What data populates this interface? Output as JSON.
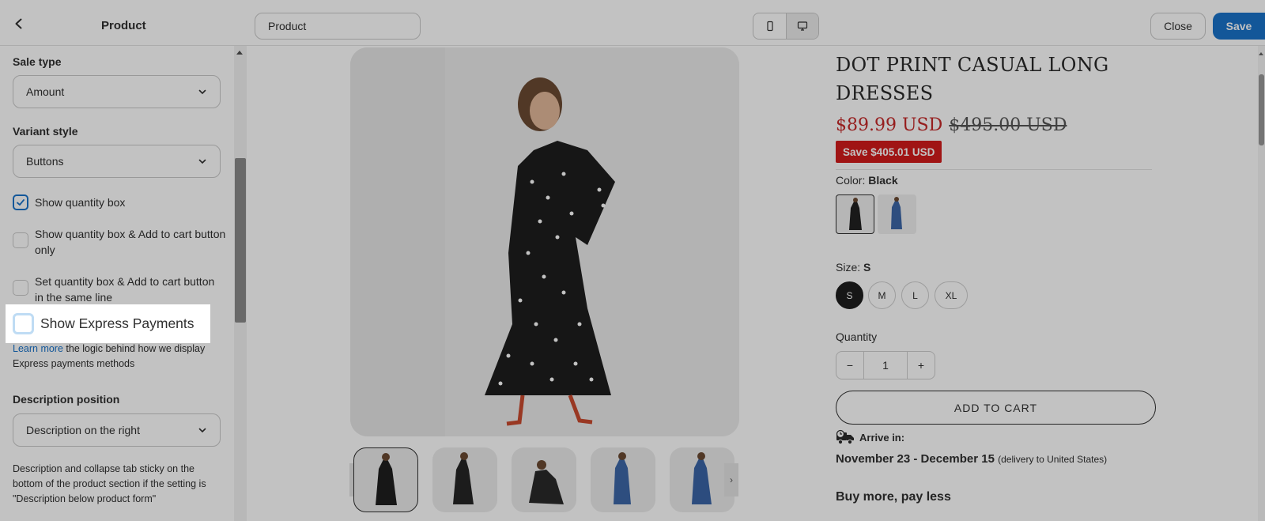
{
  "topbar": {
    "title": "Product",
    "page_select": "Product",
    "close_label": "Close",
    "save_label": "Save",
    "save_color": "#1a73c9"
  },
  "sidebar": {
    "sale_type_heading": "Sale type",
    "sale_type_value": "Amount",
    "variant_style_heading": "Variant style",
    "variant_style_value": "Buttons",
    "checkboxes": [
      {
        "label": "Show quantity box",
        "checked": true
      },
      {
        "label": "Show quantity box & Add to cart button only",
        "checked": false
      },
      {
        "label": "Set quantity box & Add to cart button in the same line",
        "checked": false
      },
      {
        "label": "Show Express Payments",
        "checked": false
      }
    ],
    "learn_more_link": "Learn more",
    "learn_more_text": " the logic behind how we display Express payments methods",
    "description_position_heading": "Description position",
    "description_position_value": "Description on the right",
    "description_note": "Description and collapse tab sticky on the bottom of the product section if the setting is \"Description below product form\""
  },
  "product": {
    "title": "DOT PRINT CASUAL LONG DRESSES",
    "price": "$89.99 USD",
    "compare_price": "$495.00 USD",
    "save_badge": "Save $405.01 USD",
    "color_label": "Color:",
    "color_value": "Black",
    "size_label": "Size:",
    "size_value": "S",
    "sizes": [
      "S",
      "M",
      "L",
      "XL"
    ],
    "quantity_label": "Quantity",
    "quantity_value": "1",
    "quantity_minus": "−",
    "quantity_plus": "+",
    "add_to_cart": "ADD TO CART",
    "arrive_label": "Arrive in:",
    "delivery_dates": "November 23 - December 15",
    "delivery_note": "(delivery to United States)",
    "buy_more": "Buy more, pay less",
    "price_color": "#c62828",
    "badge_color": "#d31b1b"
  },
  "icons": [
    "chevron-left-icon",
    "chevron-down-icon",
    "mobile-icon",
    "desktop-icon",
    "checkmark-icon",
    "delivery-truck-icon"
  ]
}
